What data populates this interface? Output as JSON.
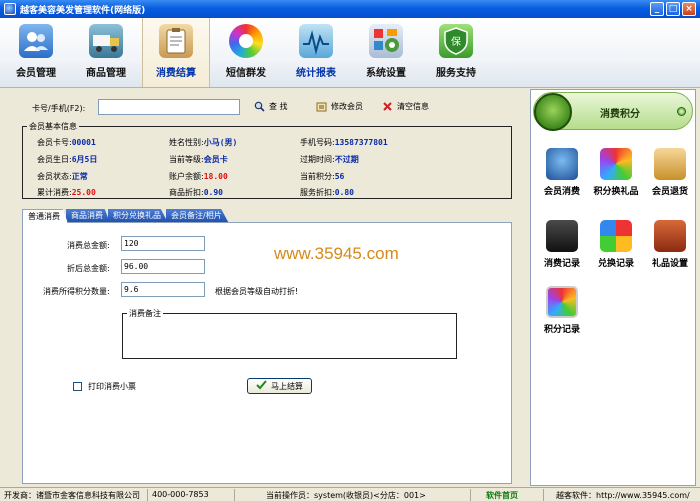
{
  "window": {
    "title": "越客美容美发管理软件(网络版)"
  },
  "toolbar": {
    "items": [
      {
        "label": "会员管理",
        "icon": "member-card-icon"
      },
      {
        "label": "商品管理",
        "icon": "goods-truck-icon"
      },
      {
        "label": "消费结算",
        "icon": "checkout-clipboard-icon",
        "active": true
      },
      {
        "label": "短信群发",
        "icon": "sms-colorwheel-icon"
      },
      {
        "label": "统计报表",
        "icon": "statistics-chart-icon"
      },
      {
        "label": "系统设置",
        "icon": "settings-gear-icon"
      },
      {
        "label": "服务支持",
        "icon": "support-shield-icon"
      }
    ]
  },
  "search": {
    "label": "卡号/手机(F2):",
    "value": "",
    "query_label": "查 找",
    "edit_member_label": "修改会员",
    "clear_label": "清空信息"
  },
  "member": {
    "group_title": "会员基本信息",
    "card_no_label": "会员卡号:",
    "card_no": "00001",
    "name_label": "姓名性别:",
    "name": "小马(男)",
    "phone_label": "手机号码:",
    "phone": "13587377801",
    "birthday_label": "会员生日:",
    "birthday": "6月5日",
    "level_label": "当前等级:",
    "level": "会员卡",
    "expire_label": "过期时间:",
    "expire": "不过期",
    "status_label": "会员状态:",
    "status": "正常",
    "balance_label": "账户余额:",
    "balance": "18.00",
    "points_label": "当前积分:",
    "points": "56",
    "total_label": "累计消费:",
    "total": "25.00",
    "goods_discount_label": "商品折扣:",
    "goods_discount": "0.90",
    "service_discount_label": "服务折扣:",
    "service_discount": "0.80"
  },
  "tabs": [
    "普通消费",
    "商品消费",
    "积分兑换礼品",
    "会员备注/相片"
  ],
  "consume": {
    "total_label": "消费总金额:",
    "total_value": "120",
    "discounted_label": "折后总金额:",
    "discounted_value": "96.00",
    "points_label": "消费所得积分数量:",
    "points_value": "9.6",
    "auto_discount_hint": "根据会员等级自动打折!",
    "note_label": "消费备注",
    "print_label": "打印消费小票",
    "settle_label": "马上结算"
  },
  "watermark": "www.35945.com",
  "right_panel": {
    "title": "消费积分",
    "items": [
      {
        "label": "会员消费",
        "icon": "member-consume-icon"
      },
      {
        "label": "积分换礼品",
        "icon": "points-gift-icon"
      },
      {
        "label": "会员退货",
        "icon": "member-return-icon"
      },
      {
        "label": "消费记录",
        "icon": "consume-record-icon"
      },
      {
        "label": "兑换记录",
        "icon": "exchange-record-icon"
      },
      {
        "label": "礼品设置",
        "icon": "gift-settings-icon"
      },
      {
        "label": "积分记录",
        "icon": "points-record-icon"
      }
    ]
  },
  "statusbar": {
    "developer": "开发商：诸暨市金客信息科技有限公司",
    "phone": "400-000-7853",
    "operator": "当前操作员：system(收银员)<分店：001>",
    "home_link": "软件首页",
    "site": "越客软件：http://www.35945.com/"
  },
  "colors": {
    "accent": "#0a2aa8",
    "highlight": "#e01010",
    "watermark": "#d68a1a",
    "titlebar": "#0a5ee0"
  }
}
